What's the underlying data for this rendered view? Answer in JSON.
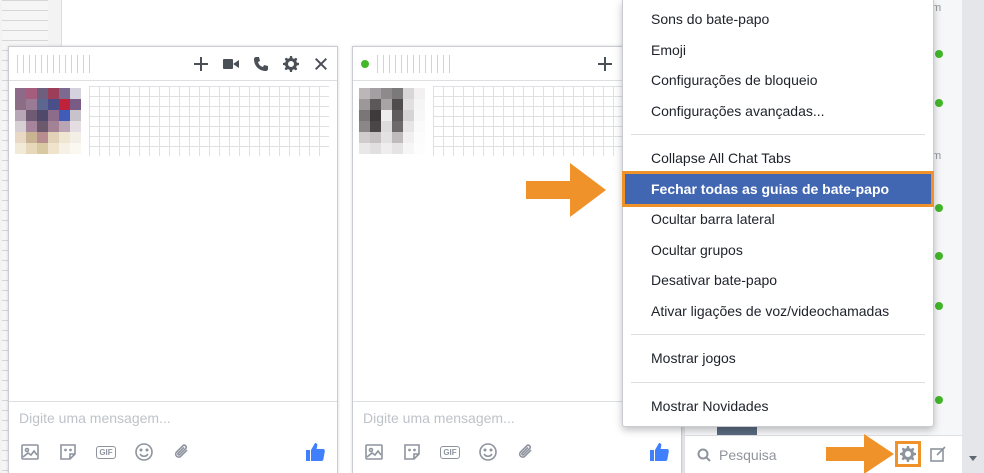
{
  "chat_a": {
    "input_placeholder": "Digite uma mensagem...",
    "footer_gif": "GIF"
  },
  "chat_b": {
    "input_placeholder": "Digite uma mensagem...",
    "footer_gif": "GIF"
  },
  "menu": {
    "group1": [
      "Sons do bate-papo",
      "Emoji",
      "Configurações de bloqueio",
      "Configurações avançadas..."
    ],
    "group2": [
      "Collapse All Chat Tabs",
      "Fechar todas as guias de bate-papo",
      "Ocultar barra lateral",
      "Ocultar grupos",
      "Desativar bate-papo",
      "Ativar ligações de voz/videochamadas"
    ],
    "group3": [
      "Mostrar jogos"
    ],
    "group4": [
      "Mostrar Novidades"
    ],
    "highlighted_item": "Fechar todas as guias de bate-papo"
  },
  "sidebar": {
    "search_placeholder": "Pesquisa",
    "time_labels": [
      "m",
      "m"
    ]
  },
  "colors": {
    "highlight_bg": "#4267b2",
    "annotation": "#f0922a",
    "online": "#42b72a",
    "like": "#4080ff"
  },
  "icons": [
    "plus-icon",
    "video-icon",
    "phone-icon",
    "gear-icon",
    "close-icon",
    "image-icon",
    "sticker-icon",
    "gif-icon",
    "emoji-icon",
    "attach-icon",
    "like-icon",
    "search-icon",
    "compose-icon"
  ]
}
